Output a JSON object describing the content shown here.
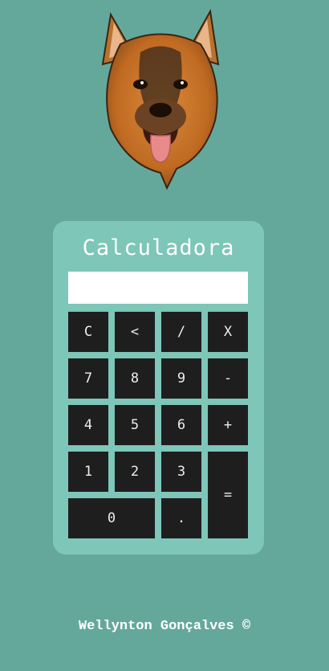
{
  "calculator": {
    "title": "Calculadora",
    "display_value": "",
    "buttons": {
      "clear": "C",
      "backspace": "<",
      "divide": "/",
      "multiply": "X",
      "seven": "7",
      "eight": "8",
      "nine": "9",
      "minus": "-",
      "four": "4",
      "five": "5",
      "six": "6",
      "plus": "+",
      "one": "1",
      "two": "2",
      "three": "3",
      "equals": "=",
      "zero": "0",
      "decimal": "."
    }
  },
  "footer": {
    "text": "Wellynton Gonçalves ©"
  },
  "colors": {
    "page_background": "#64a89c",
    "panel_background": "#7dc6b8",
    "button_background": "#1e1e1e",
    "button_text": "#eeeeee"
  }
}
